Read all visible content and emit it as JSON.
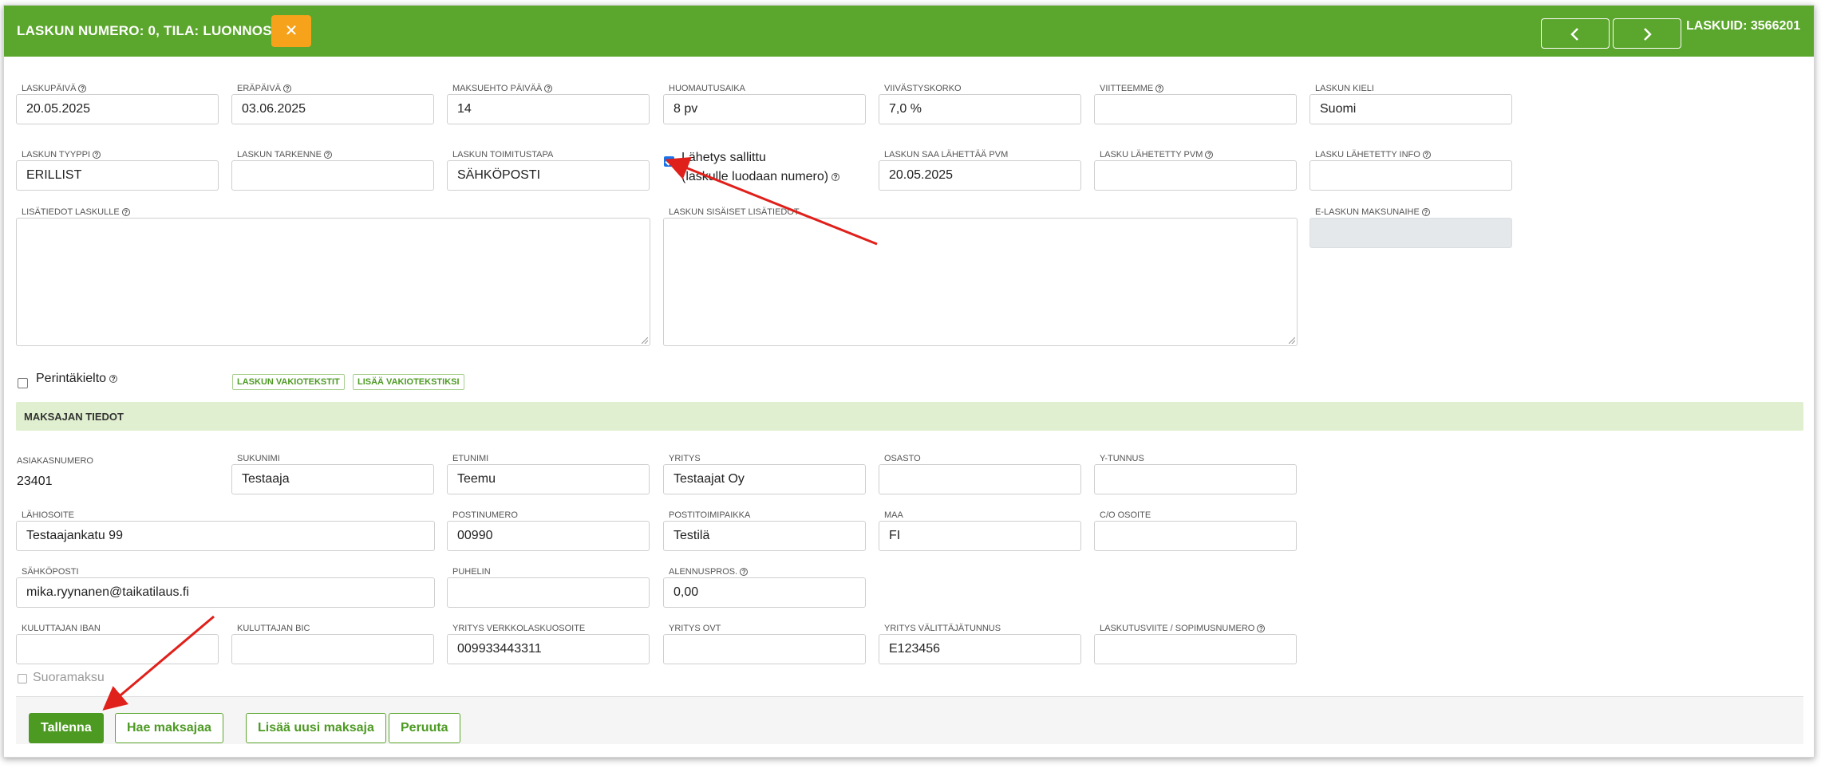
{
  "header": {
    "title_prefix": "LASKUN NUMERO: 0, TILA: ",
    "status": "LUONNOS",
    "laskuid": "LASKUID: 3566201",
    "close_icon": "close-icon",
    "prev_icon": "chevron-left-icon",
    "next_icon": "chevron-right-icon"
  },
  "help_glyph": "?",
  "invoice": {
    "laskupaiva": {
      "label": "LASKUPÄIVÄ",
      "value": "20.05.2025"
    },
    "erapaiva": {
      "label": "ERÄPÄIVÄ",
      "value": "03.06.2025"
    },
    "maksuehto": {
      "label": "MAKSUEHTO PÄIVÄÄ",
      "value": "14"
    },
    "huomautusaika": {
      "label": "HUOMAUTUSAIKA",
      "value": "8 pv"
    },
    "viivastyskorko": {
      "label": "VIIVÄSTYSKORKO",
      "value": "7,0 %"
    },
    "viitteemme": {
      "label": "VIITTEEMME",
      "value": ""
    },
    "kieli": {
      "label": "LASKUN KIELI",
      "value": "Suomi"
    },
    "tyyppi": {
      "label": "LASKUN TYYPPI",
      "value": "ERILLIST"
    },
    "tarkenne": {
      "label": "LASKUN TARKENNE",
      "value": ""
    },
    "toimitustapa": {
      "label": "LASKUN TOIMITUSTAPA",
      "value": "SÄHKÖPOSTI"
    },
    "lahetys_sallittu": {
      "line1": "Lähetys sallittu",
      "line2": "(laskulle luodaan numero)",
      "checked": true
    },
    "saa_lahettaa_pvm": {
      "label": "LASKUN SAA LÄHETTÄÄ PVM",
      "value": "20.05.2025"
    },
    "lahetetty_pvm": {
      "label": "LASKU LÄHETETTY PVM",
      "value": ""
    },
    "lahetetty_info": {
      "label": "LASKU LÄHETETTY INFO",
      "value": ""
    },
    "lisatiedot": {
      "label": "LISÄTIEDOT LASKULLE"
    },
    "sisaiset_lisatiedot": {
      "label": "LASKUN SISÄISET LISÄTIEDOT"
    },
    "e_laskun_maksunaihe": {
      "label": "E-LASKUN MAKSUNAIHE",
      "value": ""
    },
    "perintakielto": {
      "label": "Perintäkielto",
      "checked": false
    },
    "vakiotekstit_button": "LASKUN VAKIOTEKSTIT",
    "lisaa_vakioteksti_button": "LISÄÄ VAKIOTEKSTIKSI"
  },
  "payer": {
    "section_title": "MAKSAJAN TIEDOT",
    "asiakasnumero": {
      "label": "ASIAKASNUMERO",
      "value": "23401"
    },
    "sukunimi": {
      "label": "SUKUNIMI",
      "value": "Testaaja"
    },
    "etunimi": {
      "label": "ETUNIMI",
      "value": "Teemu"
    },
    "yritys": {
      "label": "YRITYS",
      "value": "Testaajat Oy"
    },
    "osasto": {
      "label": "OSASTO",
      "value": ""
    },
    "ytunnus": {
      "label": "Y-TUNNUS",
      "value": ""
    },
    "lahiosoite": {
      "label": "LÄHIOSOITE",
      "value": "Testaajankatu 99"
    },
    "postinumero": {
      "label": "POSTINUMERO",
      "value": "00990"
    },
    "postitoimipaikka": {
      "label": "POSTITOIMIPAIKKA",
      "value": "Testilä"
    },
    "maa": {
      "label": "MAA",
      "value": "FI"
    },
    "co_osoite": {
      "label": "C/O OSOITE",
      "value": ""
    },
    "sahkoposti": {
      "label": "SÄHKÖPOSTI",
      "value": "mika.ryynanen@taikatilaus.fi"
    },
    "puhelin": {
      "label": "PUHELIN",
      "value": ""
    },
    "alennuspros": {
      "label": "ALENNUSPROS.",
      "value": "0,00"
    },
    "iban": {
      "label": "KULUTTAJAN IBAN",
      "value": ""
    },
    "bic": {
      "label": "KULUTTAJAN BIC",
      "value": ""
    },
    "verkkolaskuosoite": {
      "label": "YRITYS VERKKOLASKUOSOITE",
      "value": "009933443311"
    },
    "ovt": {
      "label": "YRITYS OVT",
      "value": ""
    },
    "valittajatunnus": {
      "label": "YRITYS VÄLITTÄJÄTUNNUS",
      "value": "E123456"
    },
    "laskutusviite": {
      "label": "LASKUTUSVIITE / SOPIMUSNUMERO",
      "value": ""
    },
    "suoramaksu": {
      "label": "Suoramaksu",
      "checked": false
    }
  },
  "footer": {
    "save": "Tallenna",
    "fetch_payer": "Hae maksajaa",
    "add_payer": "Lisää uusi maksaja",
    "cancel": "Peruuta"
  },
  "colors": {
    "brand_green": "#5ba62c",
    "close_orange": "#f7a21b",
    "section_bg": "#e0efcf",
    "annotation_arrow": "#e0201b"
  }
}
